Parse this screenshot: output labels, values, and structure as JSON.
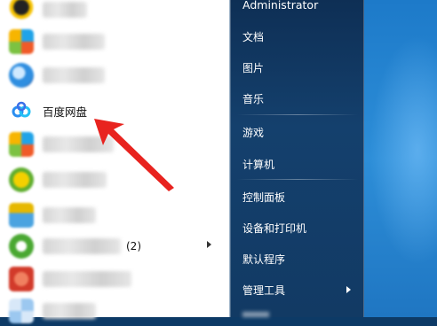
{
  "left_panel": {
    "items": [
      {
        "icon": "penguin-app-icon",
        "label": "",
        "blurred": true
      },
      {
        "icon": "colorful-tiles-app-icon",
        "label": "",
        "blurred": true
      },
      {
        "icon": "blue-circle-app-icon",
        "label": "",
        "blurred": true
      },
      {
        "icon": "baidu-netdisk-icon",
        "label": "百度网盘",
        "blurred": false
      },
      {
        "icon": "colorful-tiles-app-icon",
        "label": "",
        "blurred": true
      },
      {
        "icon": "yellow-green-app-icon",
        "label": "",
        "blurred": true
      },
      {
        "icon": "folder-app-icon",
        "label": "",
        "blurred": true
      },
      {
        "icon": "green-app-icon",
        "label": "",
        "count": "(2)",
        "blurred": true,
        "has_submenu": true
      },
      {
        "icon": "red-app-icon",
        "label": "",
        "blurred": true
      },
      {
        "icon": "light-tiles-app-icon",
        "label": "",
        "blurred": true
      }
    ]
  },
  "right_panel": {
    "user": "Administrator",
    "items": [
      {
        "label": "文档"
      },
      {
        "label": "图片"
      },
      {
        "label": "音乐"
      },
      {
        "label": "游戏"
      },
      {
        "label": "计算机"
      },
      {
        "label": "控制面板"
      },
      {
        "label": "设备和打印机"
      },
      {
        "label": "默认程序"
      },
      {
        "label": "管理工具",
        "has_submenu": true
      }
    ]
  },
  "colors": {
    "annotation_arrow": "#e8231f",
    "right_panel_bg": "#123a64",
    "desktop_bg": "#2d8ed8"
  }
}
